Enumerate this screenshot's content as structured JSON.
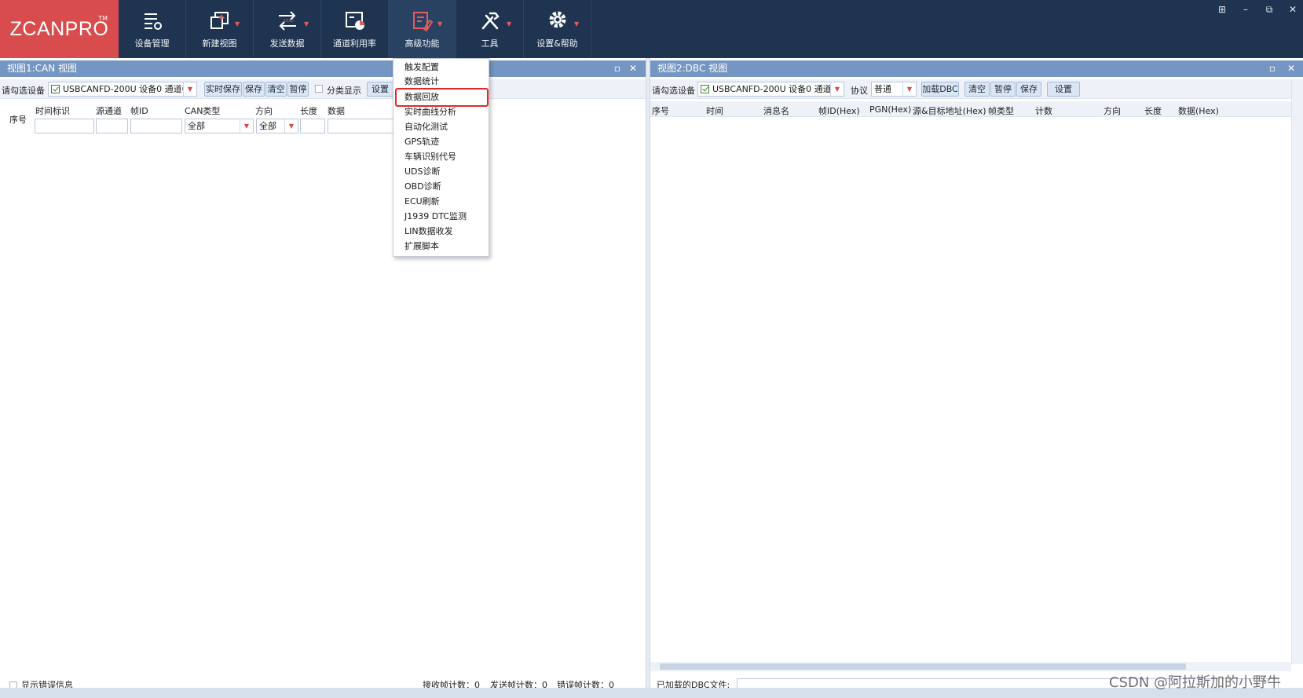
{
  "app": {
    "logo": "ZCANPRO",
    "logo_tm": "TM"
  },
  "toolbar": [
    {
      "label": "设备管理",
      "icon": "device-manage-icon",
      "dropdown": false
    },
    {
      "label": "新建视图",
      "icon": "new-view-icon",
      "dropdown": true
    },
    {
      "label": "发送数据",
      "icon": "send-data-icon",
      "dropdown": true
    },
    {
      "label": "通道利用率",
      "icon": "channel-usage-icon",
      "dropdown": false
    },
    {
      "label": "高级功能",
      "icon": "advanced-icon",
      "dropdown": true
    },
    {
      "label": "工具",
      "icon": "tools-icon",
      "dropdown": true
    },
    {
      "label": "设置&帮助",
      "icon": "settings-icon",
      "dropdown": true
    }
  ],
  "window_controls": [
    "⊞",
    "–",
    "⧉",
    "✕"
  ],
  "left_panel": {
    "title": "视图1:CAN 视图",
    "device_label": "请勾选设备",
    "device_value": "USBCANFD-200U 设备0 通道0",
    "buttons": [
      "实时保存",
      "保存",
      "清空",
      "暂停"
    ],
    "classify_label": "分类显示",
    "settings_button": "设置",
    "row_number_header": "序号",
    "columns": [
      "时间标识",
      "源通道",
      "帧ID",
      "CAN类型",
      "方向",
      "长度",
      "数据"
    ],
    "filter_can_type": "全部",
    "filter_direction": "全部",
    "status_error": "显示错误信息",
    "status_recv": "接收帧计数：0",
    "status_send": "发送帧计数：0",
    "status_err_count": "错误帧计数：0"
  },
  "right_panel": {
    "title": "视图2:DBC 视图",
    "device_label": "请勾选设备",
    "device_value": "USBCANFD-200U 设备0 通道0",
    "protocol_label": "协议",
    "protocol_value": "普通",
    "buttons": [
      "加载DBC",
      "清空",
      "暂停",
      "保存"
    ],
    "settings_button": "设置",
    "columns": [
      "序号",
      "时间",
      "消息名",
      "帧ID(Hex)",
      "PGN(Hex)",
      "源&目标地址(Hex)",
      "帧类型",
      "计数",
      "方向",
      "长度",
      "数据(Hex)"
    ],
    "status_dbc": "已加载的DBC文件:"
  },
  "advanced_menu": {
    "items": [
      "触发配置",
      "数据统计",
      "数据回放",
      "实时曲线分析",
      "自动化测试",
      "GPS轨迹",
      "车辆识别代号",
      "UDS诊断",
      "OBD诊断",
      "ECU刷新",
      "J1939 DTC监测",
      "LIN数据收发",
      "扩展脚本"
    ],
    "highlighted": "数据回放"
  },
  "watermark": "CSDN @阿拉斯加的小野牛",
  "colors": {
    "topbar": "#1f3450",
    "logo_bg": "#d94c4e",
    "panel_header": "#7596c2",
    "highlight": "#e02a2a"
  }
}
